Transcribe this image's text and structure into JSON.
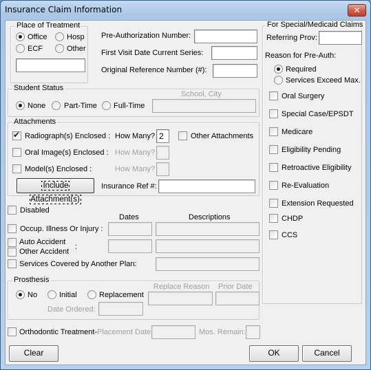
{
  "window": {
    "title": "Insurance Claim Information",
    "close_label": "✕"
  },
  "place_of_treatment": {
    "label": "Place of Treatment",
    "options": [
      {
        "label": "Office",
        "selected": true
      },
      {
        "label": "Hosp",
        "selected": false
      },
      {
        "label": "ECF",
        "selected": false
      },
      {
        "label": "Other",
        "selected": false
      }
    ],
    "other_value": ""
  },
  "pre_auth": {
    "pre_authorization_label": "Pre-Authorization Number:",
    "pre_authorization_value": "",
    "first_visit_label": "First Visit Date Current Series:",
    "first_visit_value": "",
    "original_ref_label": "Original Reference Number (#):",
    "original_ref_value": ""
  },
  "student_status": {
    "label": "Student Status",
    "options": [
      {
        "label": "None",
        "selected": true
      },
      {
        "label": "Part-Time",
        "selected": false
      },
      {
        "label": "Full-Time",
        "selected": false
      }
    ],
    "school_city_label": "School, City",
    "school_city_value": ""
  },
  "attachments": {
    "label": "Attachments",
    "radiograph": {
      "label": "Radiograph(s) Enclosed :",
      "checked": true,
      "how_many_label": "How Many?",
      "how_many_value": "2"
    },
    "other_attachments": {
      "label": "Other Attachments",
      "checked": false
    },
    "oral_image": {
      "label": "Oral Image(s) Enclosed :",
      "checked": false,
      "how_many_label": "How Many?",
      "how_many_value": ""
    },
    "models": {
      "label": "Model(s) Enclosed :",
      "checked": false,
      "how_many_label": "How Many?",
      "how_many_value": ""
    },
    "include_button": "Include Attachment(s)",
    "insurance_ref_label": "Insurance Ref #:",
    "insurance_ref_value": ""
  },
  "conditions": {
    "disabled_label": "Disabled",
    "dates_header": "Dates",
    "descriptions_header": "Descriptions",
    "occup_label": "Occup. Illness Or Injury :",
    "auto_accident_label": "Auto Accident",
    "other_accident_label": "Other Accident",
    "accident_colon": ":",
    "services_covered_label": "Services Covered by Another Plan:"
  },
  "prosthesis": {
    "label": "Prosthesis",
    "options": [
      {
        "label": "No",
        "selected": true
      },
      {
        "label": "Initial",
        "selected": false
      },
      {
        "label": "Replacement",
        "selected": false
      }
    ],
    "replace_reason_label": "Replace Reason",
    "prior_date_label": "Prior Date",
    "date_ordered_label": "Date Ordered:"
  },
  "orthodontic": {
    "label": "Orthodontic Treatment-",
    "checked": false,
    "placement_date_label": "Placement Date:",
    "mos_remain_label": "Mos. Remain:"
  },
  "medicaid": {
    "label": "For Special/Medicaid Claims",
    "referring_prov_label": "Referring Prov:",
    "referring_prov_value": "",
    "reason_label": "Reason for Pre-Auth:",
    "reason_options": [
      {
        "label": "Required",
        "selected": true
      },
      {
        "label": "Services Exceed Max.",
        "selected": false
      }
    ],
    "checkboxes": [
      {
        "label": "Oral Surgery",
        "checked": false
      },
      {
        "label": "Special Case/EPSDT",
        "checked": false
      },
      {
        "label": "Medicare",
        "checked": false
      },
      {
        "label": "Eligibility Pending",
        "checked": false
      },
      {
        "label": "Retroactive Eligibility",
        "checked": false
      },
      {
        "label": "Re-Evaluation",
        "checked": false
      },
      {
        "label": "Extension Requested",
        "checked": false
      },
      {
        "label": "CHDP",
        "checked": false
      },
      {
        "label": "CCS",
        "checked": false
      }
    ]
  },
  "buttons": {
    "clear": "Clear",
    "ok": "OK",
    "cancel": "Cancel"
  }
}
